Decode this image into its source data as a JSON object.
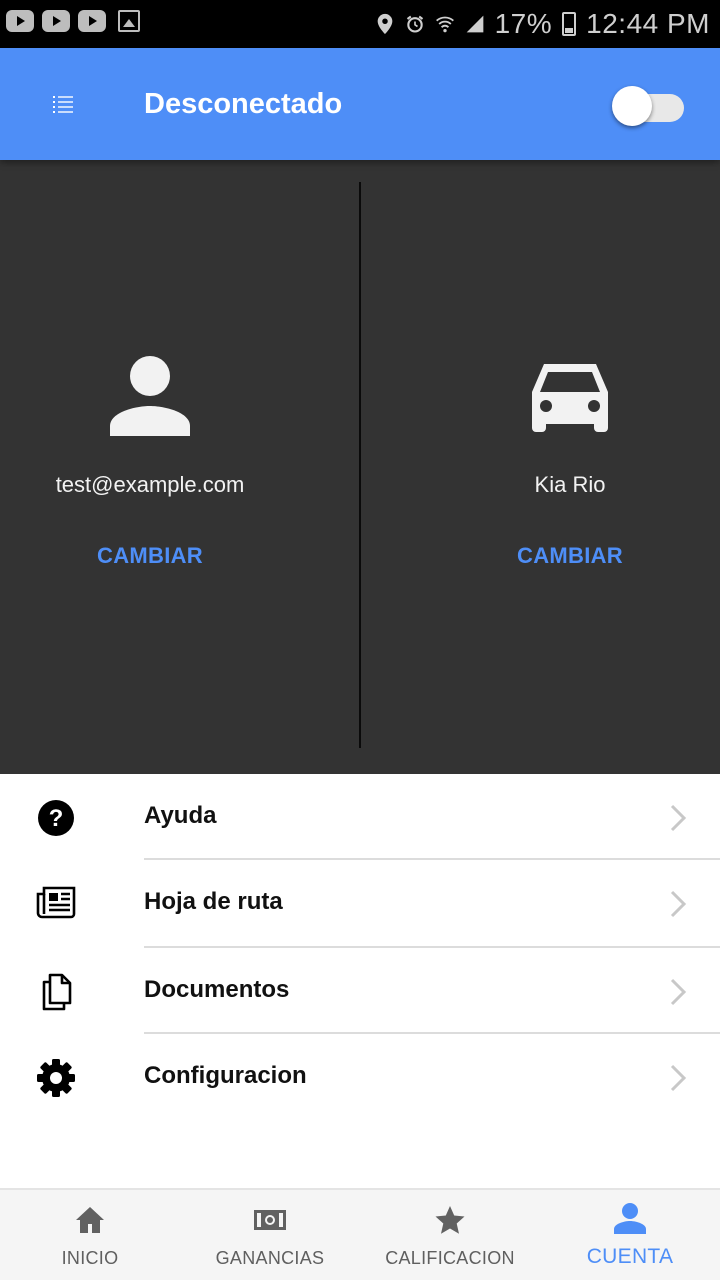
{
  "status_bar": {
    "battery": "17%",
    "time": "12:44 PM"
  },
  "app_bar": {
    "title": "Desconectado",
    "online_toggle_on": false,
    "accent_color": "#4e8ef7"
  },
  "profile": {
    "user": {
      "icon": "person-icon",
      "email": "test@example.com",
      "change_label": "CAMBIAR"
    },
    "vehicle": {
      "icon": "car-icon",
      "name": "Kia Rio",
      "change_label": "CAMBIAR"
    }
  },
  "menu": {
    "items": [
      {
        "icon": "help-icon",
        "label": "Ayuda"
      },
      {
        "icon": "newspaper-icon",
        "label": "Hoja de ruta"
      },
      {
        "icon": "documents-icon",
        "label": "Documentos"
      },
      {
        "icon": "gear-icon",
        "label": "Configuracion"
      }
    ]
  },
  "bottom_nav": {
    "items": [
      {
        "icon": "home-icon",
        "label": "INICIO",
        "active": false
      },
      {
        "icon": "money-icon",
        "label": "GANANCIAS",
        "active": false
      },
      {
        "icon": "star-icon",
        "label": "CALIFICACION",
        "active": false
      },
      {
        "icon": "account-icon",
        "label": "CUENTA",
        "active": true
      }
    ]
  }
}
